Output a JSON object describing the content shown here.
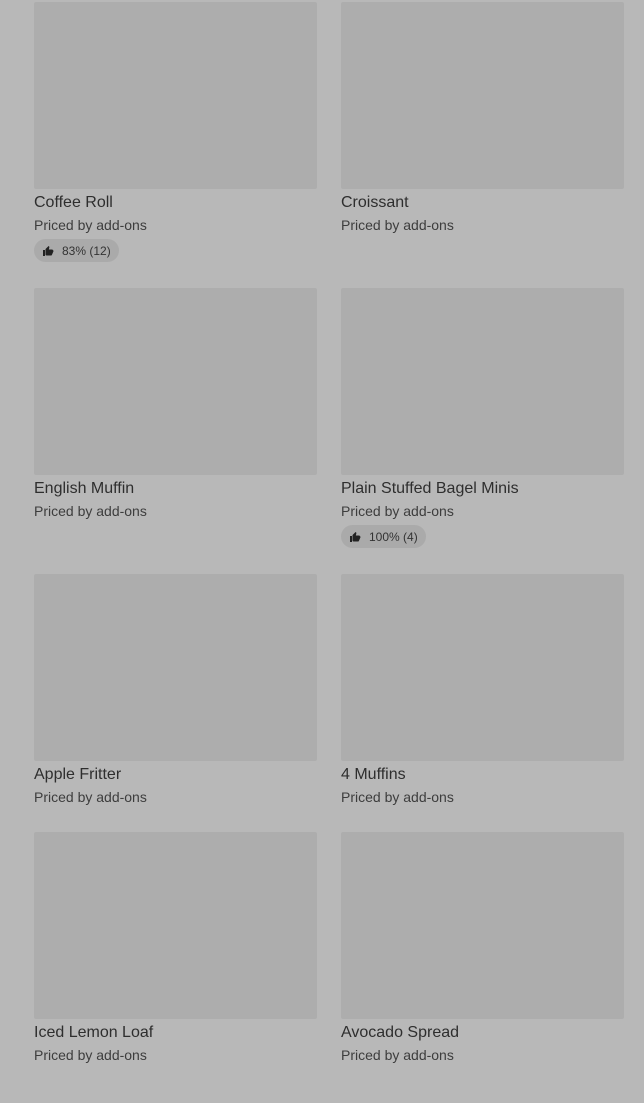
{
  "products": [
    {
      "name": "Coffee Roll",
      "price": "Priced by add-ons",
      "rating": "83% (12)"
    },
    {
      "name": "Croissant",
      "price": "Priced by add-ons"
    },
    {
      "name": "English Muffin",
      "price": "Priced by add-ons"
    },
    {
      "name": "Plain Stuffed Bagel Minis",
      "price": "Priced by add-ons",
      "rating": "100% (4)"
    },
    {
      "name": "Apple Fritter",
      "price": "Priced by add-ons"
    },
    {
      "name": "4 Muffins",
      "price": "Priced by add-ons"
    },
    {
      "name": "Iced Lemon Loaf",
      "price": "Priced by add-ons"
    },
    {
      "name": "Avocado Spread",
      "price": "Priced by add-ons"
    }
  ],
  "icons": {
    "rating": "thumbs-up-icon"
  },
  "colors": {
    "background": "#b8b8b8",
    "image_placeholder": "#adadad",
    "badge": "#aaaaaa",
    "text": "#2b2b2b"
  }
}
